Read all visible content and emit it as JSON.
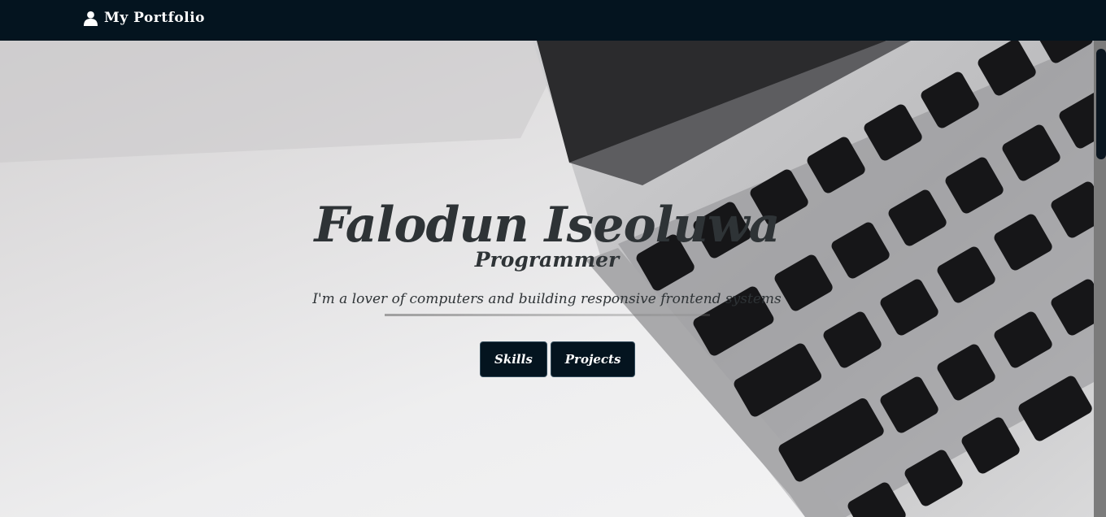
{
  "navbar": {
    "brand_label": "My Portfolio",
    "brand_icon": "user-icon"
  },
  "hero": {
    "name": "Falodun Iseoluwa",
    "role": "Programmer",
    "tagline": "I'm a lover of computers and building responsive frontend systems",
    "buttons": {
      "skills_label": "Skills",
      "projects_label": "Projects"
    }
  },
  "colors": {
    "navbar_bg": "#04141f",
    "button_bg": "#04141f",
    "heading_text": "#2e3336"
  }
}
